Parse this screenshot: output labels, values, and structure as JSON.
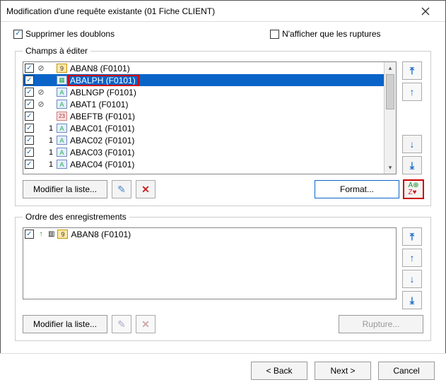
{
  "window": {
    "title": "Modification d'une requête existante (01 Fiche CLIENT)"
  },
  "options": {
    "suppress_dupes": {
      "label": "Supprimer les doublons",
      "checked": true
    },
    "ruptures_only": {
      "label": "N'afficher que les ruptures",
      "checked": false
    }
  },
  "fields_group": {
    "legend": "Champs à éditer",
    "items": [
      {
        "checked": true,
        "sort": "none",
        "ord": "",
        "type": "num",
        "glyph": "9",
        "label": "ABAN8 (F0101)",
        "selected": false
      },
      {
        "checked": true,
        "sort": "",
        "ord": "",
        "type": "txt",
        "glyph": "▦",
        "label": "ABALPH (F0101)",
        "selected": true,
        "highlight": true
      },
      {
        "checked": true,
        "sort": "none",
        "ord": "",
        "type": "txt",
        "glyph": "A",
        "label": "ABLNGP (F0101)",
        "selected": false
      },
      {
        "checked": true,
        "sort": "none",
        "ord": "",
        "type": "txt",
        "glyph": "A",
        "label": "ABAT1 (F0101)",
        "selected": false
      },
      {
        "checked": true,
        "sort": "",
        "ord": "",
        "type": "date",
        "glyph": "23",
        "label": "ABEFTB (F0101)",
        "selected": false
      },
      {
        "checked": true,
        "sort": "",
        "ord": "1",
        "type": "txt",
        "glyph": "A",
        "label": "ABAC01 (F0101)",
        "selected": false
      },
      {
        "checked": true,
        "sort": "",
        "ord": "1",
        "type": "txt",
        "glyph": "A",
        "label": "ABAC02 (F0101)",
        "selected": false
      },
      {
        "checked": true,
        "sort": "",
        "ord": "1",
        "type": "txt",
        "glyph": "A",
        "label": "ABAC03 (F0101)",
        "selected": false
      },
      {
        "checked": true,
        "sort": "",
        "ord": "1",
        "type": "txt",
        "glyph": "A",
        "label": "ABAC04 (F0101)",
        "selected": false
      }
    ],
    "modify_btn": "Modifier la liste...",
    "format_btn": "Format..."
  },
  "order_group": {
    "legend": "Ordre des enregistrements",
    "items": [
      {
        "checked": true,
        "direction": "asc",
        "type": "num",
        "glyph": "9",
        "label": "ABAN8 (F0101)"
      }
    ],
    "modify_btn": "Modifier la liste...",
    "rupture_btn": "Rupture..."
  },
  "footer": {
    "back": "< Back",
    "next": "Next >",
    "cancel": "Cancel"
  }
}
